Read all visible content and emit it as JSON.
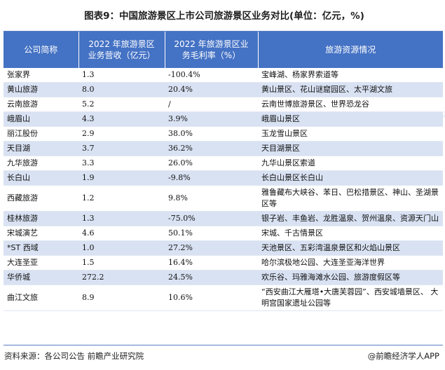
{
  "title": "图表9：中国旅游景区上市公司旅游景区业务对比(单位：亿元，%)",
  "headers": [
    "公司简称",
    "2022 年旅游景区\n业务营收（亿元）",
    "2022 年旅游景区业\n务毛利率（%）",
    "旅游资源情况"
  ],
  "rows": [
    [
      "张家界",
      "1.3",
      "-100.4%",
      "宝峰湖、杨家界索道等"
    ],
    [
      "黄山旅游",
      "8.0",
      "20.4%",
      "黄山景区、花山谜窟园区、太平湖文旅"
    ],
    [
      "云南旅游",
      "5.2",
      "/",
      "云南世博旅游景区、世界恐龙谷"
    ],
    [
      "峨眉山",
      "4.3",
      "3.9%",
      "峨眉山景区"
    ],
    [
      "丽江股份",
      "2.9",
      "38.0%",
      "玉龙雪山景区"
    ],
    [
      "天目湖",
      "3.7",
      "36.2%",
      "天目湖景区"
    ],
    [
      "九华旅游",
      "3.3",
      "26.0%",
      "九华山景区索道"
    ],
    [
      "长白山",
      "1.9",
      "-9.8%",
      "长白山景区长白山"
    ],
    [
      "西藏旅游",
      "1.2",
      "9.8%",
      "雅鲁藏布大峡谷、苯日、巴松措景区、神山、圣湖景区等"
    ],
    [
      "桂林旅游",
      "1.3",
      "-75.0%",
      "银子岩、丰鱼岩、龙胜温泉、贺州温泉、资源天门山"
    ],
    [
      "宋城演艺",
      "4.6",
      "50.1%",
      "宋城、千古情景区"
    ],
    [
      "*ST 西域",
      "1.0",
      "27.2%",
      "天池景区、五彩湾温泉景区和火焰山景区"
    ],
    [
      "大连圣亚",
      "1.5",
      "16.4%",
      "哈尔滨极地公园、大连圣亚海洋世界"
    ],
    [
      "华侨城",
      "272.2",
      "24.5%",
      "欢乐谷、玛雅海滩水公园、旅游度假区等"
    ],
    [
      "曲江文旅",
      "8.9",
      "10.6%",
      "“西安曲江大雁塔•大唐芙蓉园”、西安城墙景区、 大明宫国家遗址公园等"
    ]
  ],
  "footer": {
    "source": "资料来源：各公司公告 前瞻产业研究院",
    "brand": "@前瞻经济学人APP"
  },
  "watermark": "前瞻产业研究院",
  "colors": {
    "header_bg": "#4472c4",
    "stripe": "#d9e2f3"
  }
}
